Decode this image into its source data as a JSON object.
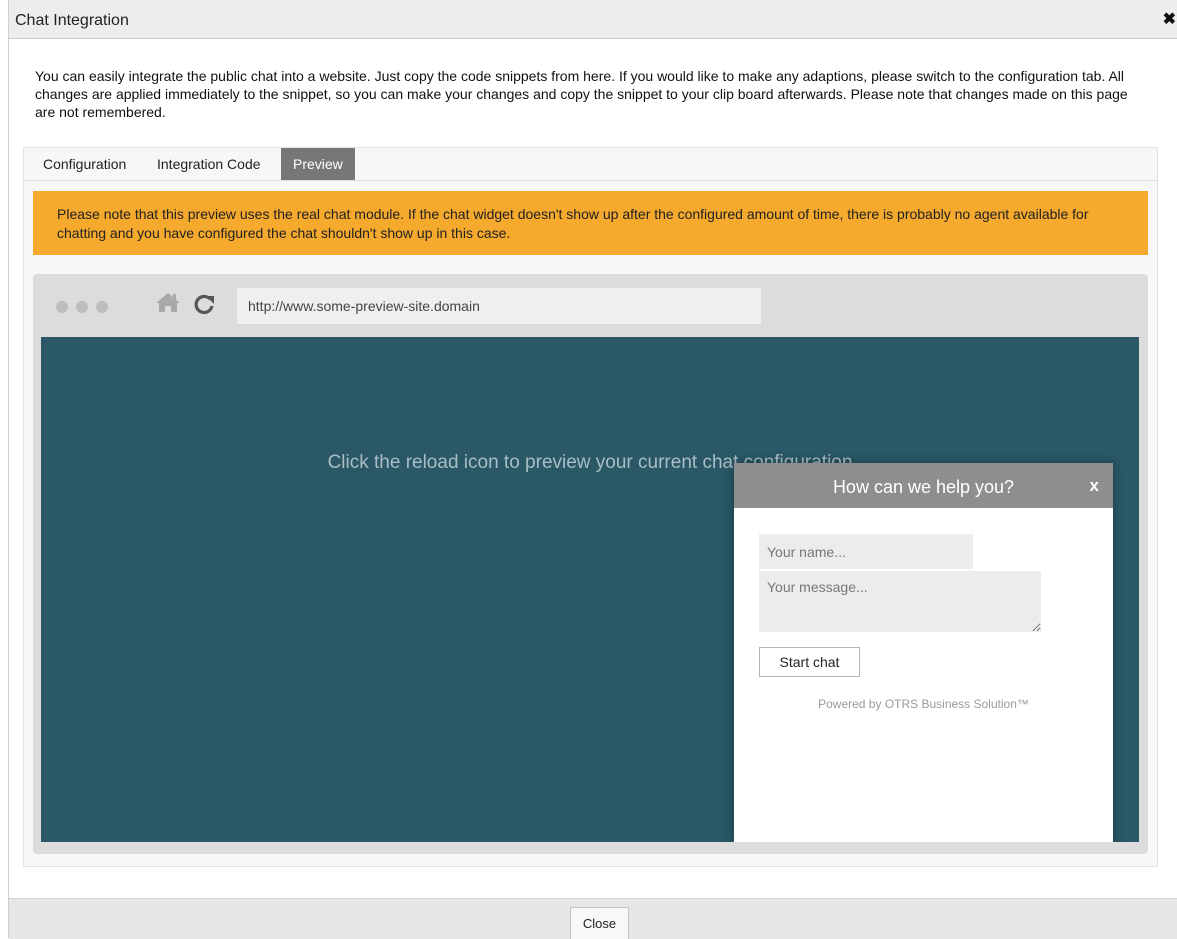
{
  "dialog": {
    "title": "Chat Integration",
    "close_glyph": "✖",
    "intro": "You can easily integrate the public chat into a website. Just copy the code snippets from here. If you would like to make any adaptions, please switch to the configuration tab. All changes are applied immediately to the snippet, so you can make your changes and copy the snippet to your clip board afterwards. Please note that changes made on this page are not remembered."
  },
  "tabs": [
    {
      "label": "Configuration",
      "active": false
    },
    {
      "label": "Integration Code",
      "active": false
    },
    {
      "label": "Preview",
      "active": true
    }
  ],
  "notice": {
    "text": "Please note that this preview uses the real chat module. If the chat widget doesn't show up after the configured amount of time, there is probably no agent available for chatting and you have configured the chat shouldn't show up in this case.",
    "color": "#f5a92d"
  },
  "browser": {
    "url": "http://www.some-preview-site.domain",
    "viewport_message": "Click the reload icon to preview your current chat configuration",
    "viewport_color": "#2a5866"
  },
  "chat_widget": {
    "title": "How can we help you?",
    "close_glyph": "x",
    "name_placeholder": "Your name...",
    "message_placeholder": "Your message...",
    "start_label": "Start chat",
    "powered_by": "Powered by OTRS Business Solution™"
  },
  "footer": {
    "close_label": "Close"
  },
  "icons": {
    "home": "home-icon",
    "reload": "reload-icon"
  }
}
